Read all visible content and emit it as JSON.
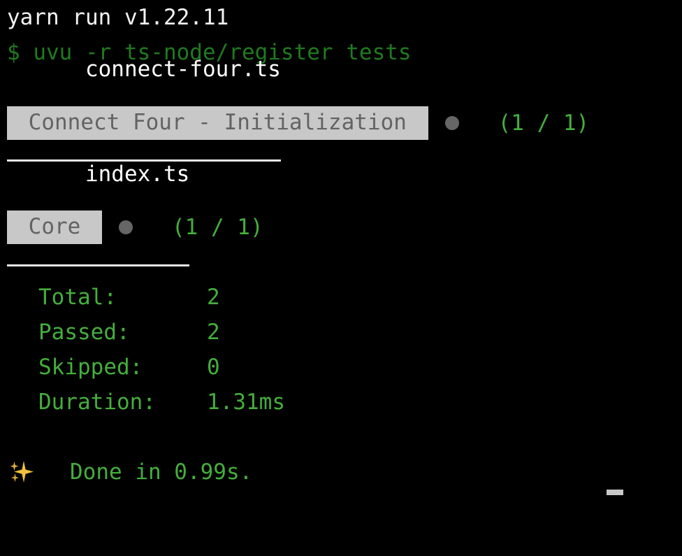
{
  "terminal": {
    "background_color": "#000000",
    "foreground_color": "#f2f2f2",
    "command_line": {
      "runner_version": "yarn run v1.22.11",
      "prompt_symbol": "$",
      "command": "uvu -r ts-node/register tests",
      "prompt_line": "$ uvu -r ts-node/register tests"
    },
    "files": [
      {
        "name": "connect-four.ts",
        "suites": [
          {
            "label": "Connect Four - Initialization",
            "chip_text": " Connect Four - Initialization ",
            "status_dot": "passed-dot",
            "ratio": "(1 / 1)",
            "ratio_color": "#45ae3c"
          }
        ]
      },
      {
        "name": "index.ts",
        "suites": [
          {
            "label": "Core",
            "chip_text": " Core ",
            "status_dot": "passed-dot",
            "ratio": "(1 / 1)",
            "ratio_color": "#45ae3c"
          }
        ]
      }
    ],
    "summary": {
      "rows": [
        {
          "label": "Total:",
          "value": "2"
        },
        {
          "label": "Passed:",
          "value": "2"
        },
        {
          "label": "Skipped:",
          "value": "0"
        },
        {
          "label": "Duration:",
          "value": "1.31ms"
        }
      ],
      "color": "#45ae3c"
    },
    "footer": {
      "icon": "sparkles-icon",
      "text": "Done in 0.99s."
    },
    "cursor": {
      "visible": true,
      "color": "#c8c8c8"
    }
  }
}
